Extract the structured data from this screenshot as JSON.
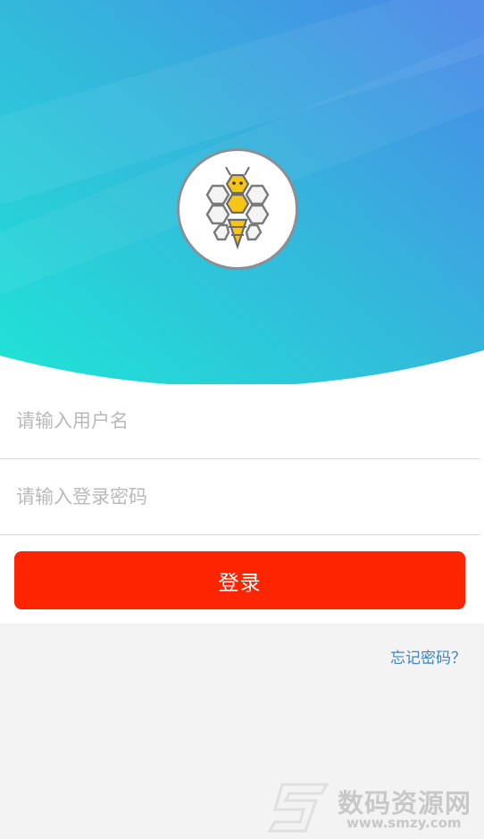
{
  "login": {
    "username_placeholder": "请输入用户名",
    "password_placeholder": "请输入登录密码",
    "login_button": "登录",
    "forgot_password": "忘记密码？"
  },
  "watermark": {
    "site_name": "数码资源网",
    "url": "www.smzy.com"
  },
  "colors": {
    "gradient_start": "#1fe4d6",
    "gradient_end": "#4a86e8",
    "accent_red": "#ff2500",
    "link_blue": "#3a86c8",
    "bee_yellow": "#f5c518"
  },
  "icons": {
    "logo": "bee-honeycomb-logo"
  }
}
